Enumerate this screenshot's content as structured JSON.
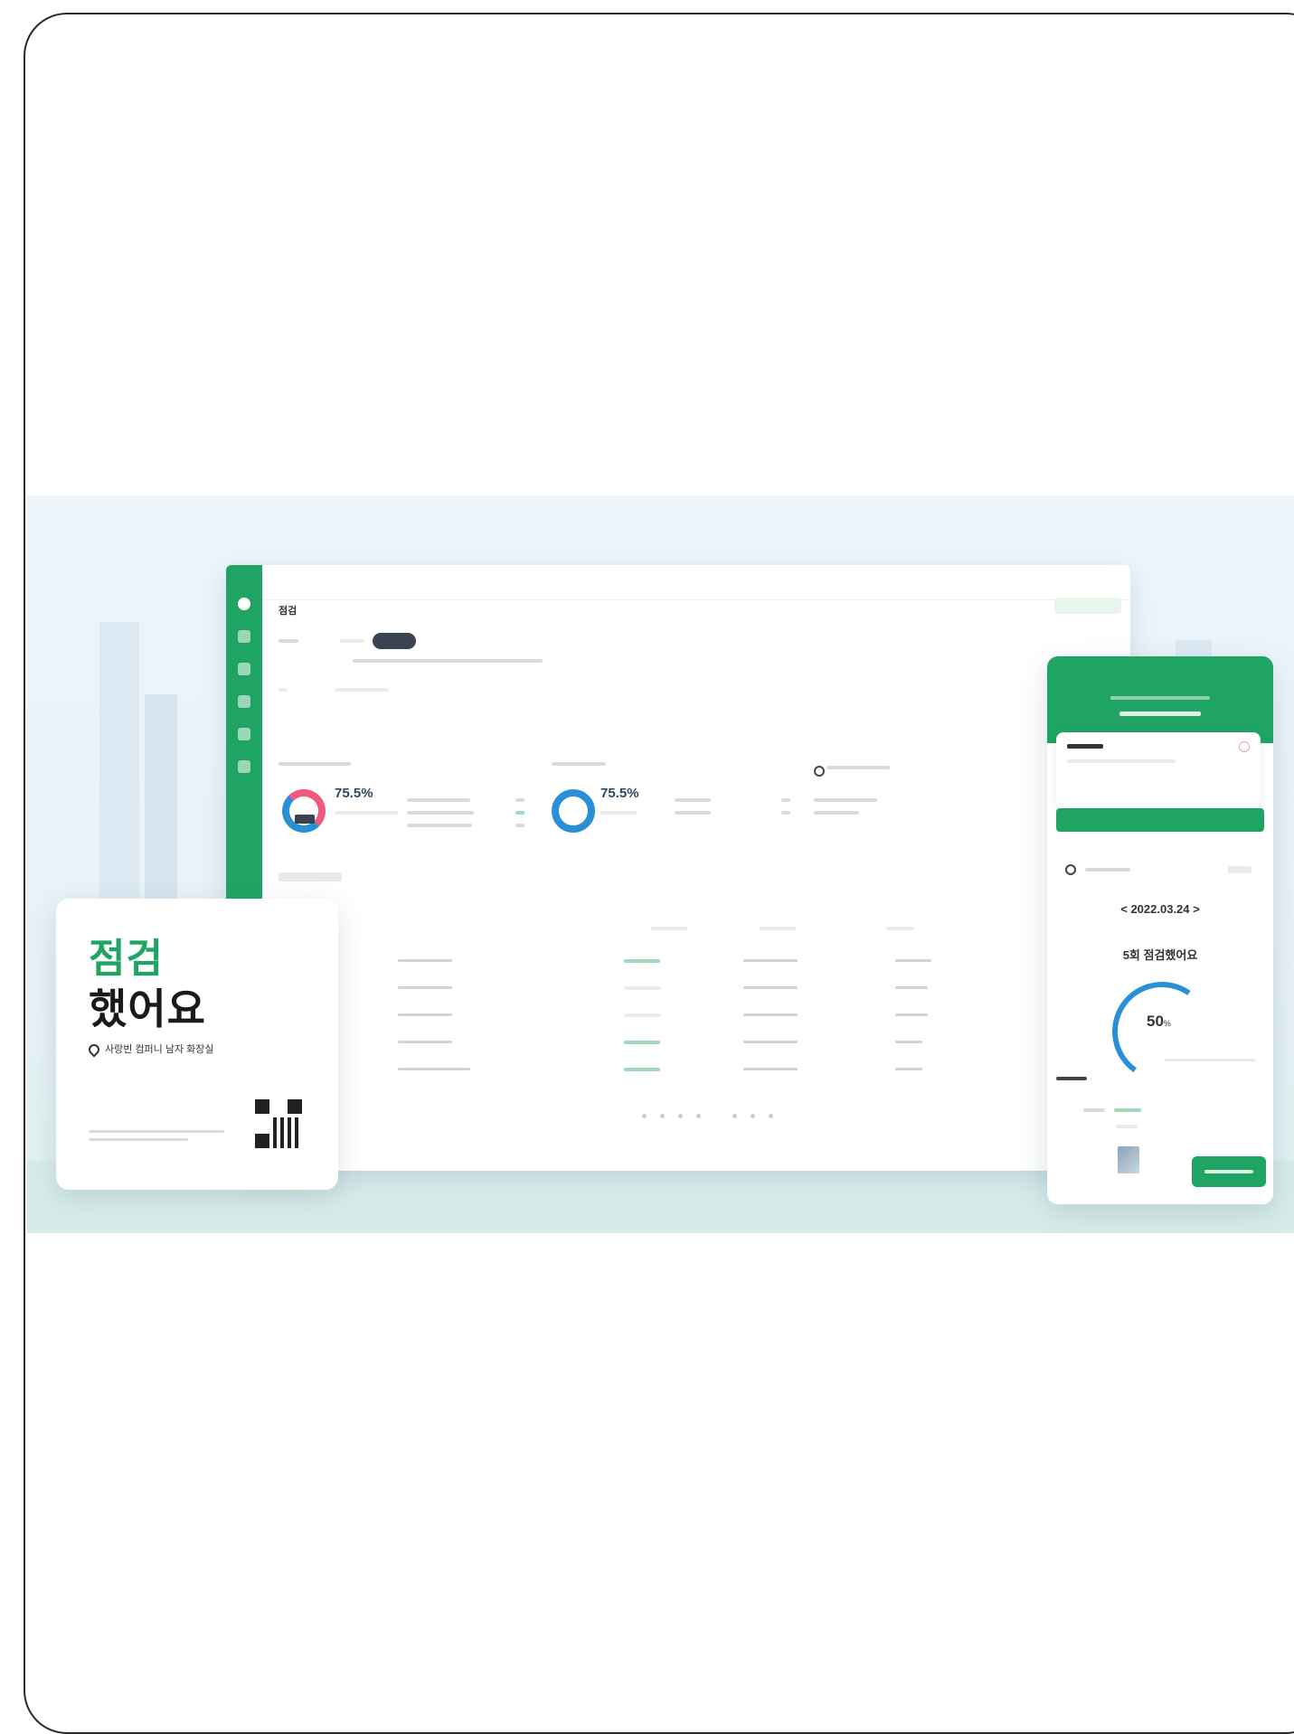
{
  "dashboard": {
    "title": "점검",
    "tab_chip": "",
    "left_donut": {
      "percent": "75.5%"
    },
    "right_donut": {
      "percent": "75.5%"
    }
  },
  "left_card": {
    "title_line1": "점검",
    "title_line2": "했어요",
    "location": "사랑빈 컴퍼니 남자 화장실"
  },
  "mobile": {
    "date": "< 2022.03.24 >",
    "message": "5회 점검했어요",
    "gauge_value": "50",
    "gauge_unit": "%"
  },
  "colors": {
    "brand_green": "#1fa463",
    "chart_blue": "#2b8fd6",
    "chart_pink": "#ef5a7e"
  }
}
